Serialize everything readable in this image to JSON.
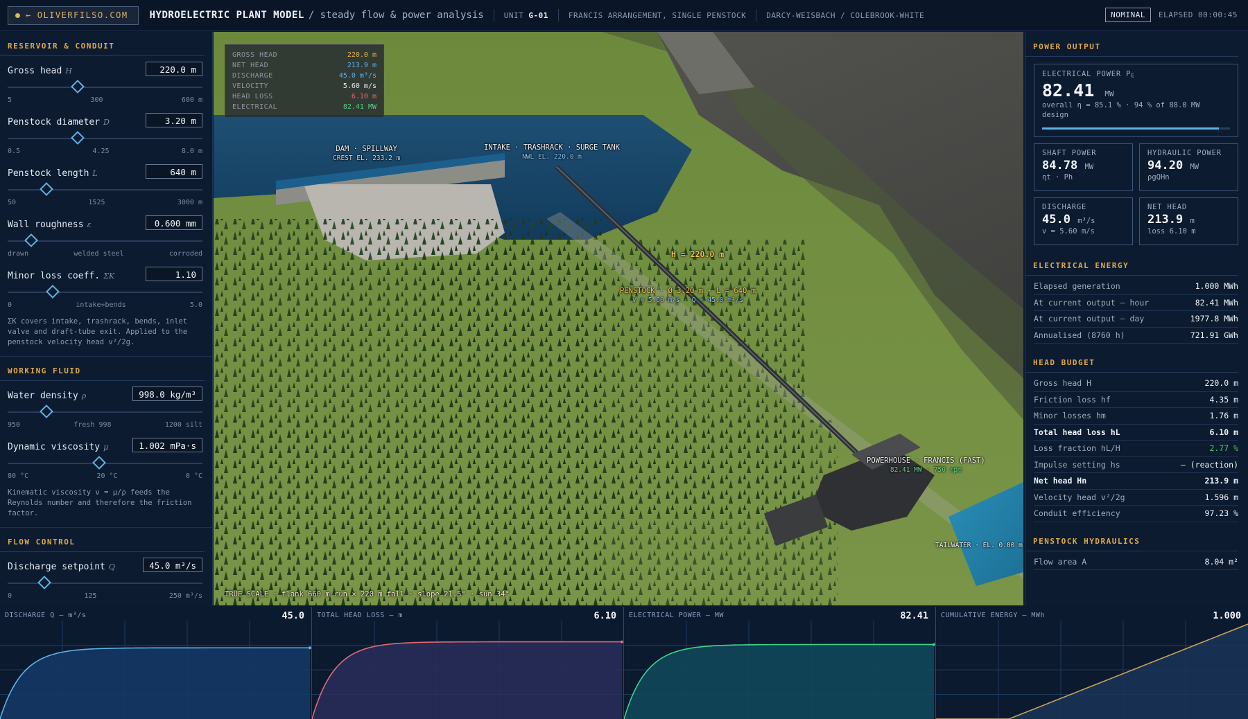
{
  "topbar": {
    "brand": "OLIVERFILSO.COM",
    "title": "HYDROELECTRIC PLANT MODEL",
    "subtitle": "/ steady flow & power analysis",
    "unit_label": "UNIT",
    "unit_value": "G-01",
    "arrangement": "FRANCIS ARRANGEMENT, SINGLE PENSTOCK",
    "method": "DARCY-WEISBACH / COLEBROOK-WHITE",
    "status": "NOMINAL",
    "elapsed": "ELAPSED 00:00:45"
  },
  "left": {
    "reservoir": {
      "title": "RESERVOIR & CONDUIT",
      "controls": [
        {
          "label": "Gross head",
          "sym": "H",
          "value": "220.0 m",
          "fraction": 0.36,
          "ticks": [
            "5",
            "300",
            "600 m"
          ]
        },
        {
          "label": "Penstock diameter",
          "sym": "D",
          "value": "3.20 m",
          "fraction": 0.36,
          "ticks": [
            "0.5",
            "4.25",
            "8.0 m"
          ]
        },
        {
          "label": "Penstock length",
          "sym": "L",
          "value": "640 m",
          "fraction": 0.2,
          "ticks": [
            "50",
            "1525",
            "3000 m"
          ]
        },
        {
          "label": "Wall roughness",
          "sym": "ε",
          "value": "0.600 mm",
          "fraction": 0.12,
          "ticks": [
            "drawn",
            "welded steel",
            "corroded"
          ]
        },
        {
          "label": "Minor loss coeff.",
          "sym": "ΣK",
          "value": "1.10",
          "fraction": 0.23,
          "ticks": [
            "0",
            "intake+bends",
            "5.0"
          ]
        }
      ],
      "note": "ΣK covers intake, trashrack, bends, inlet valve and draft-tube exit. Applied to the penstock velocity head v²/2g."
    },
    "fluid": {
      "title": "WORKING FLUID",
      "controls": [
        {
          "label": "Water density",
          "sym": "ρ",
          "value": "998.0 kg/m³",
          "fraction": 0.2,
          "ticks": [
            "950",
            "fresh 998",
            "1200 silt"
          ]
        },
        {
          "label": "Dynamic viscosity",
          "sym": "μ",
          "value": "1.002 mPa·s",
          "fraction": 0.47,
          "ticks": [
            "80 °C",
            "20 °C",
            "0 °C"
          ]
        }
      ],
      "note": "Kinematic viscosity ν = μ/ρ feeds the Reynolds number and therefore the friction factor."
    },
    "flow": {
      "title": "FLOW CONTROL",
      "controls": [
        {
          "label": "Discharge setpoint",
          "sym": "Q",
          "value": "45.0 m³/s",
          "fraction": 0.19,
          "ticks": [
            "0",
            "125",
            "250 m³/s"
          ]
        }
      ]
    }
  },
  "viewport": {
    "hud": [
      {
        "k": "GROSS HEAD",
        "v": "220.0 m",
        "color": "#e8b34d"
      },
      {
        "k": "NET HEAD",
        "v": "213.9 m",
        "color": "#5cb4e8"
      },
      {
        "k": "DISCHARGE",
        "v": "45.0 m³/s",
        "color": "#5cb4e8"
      },
      {
        "k": "VELOCITY",
        "v": "5.60 m/s",
        "color": "#e9edf3"
      },
      {
        "k": "HEAD LOSS",
        "v": "6.10 m",
        "color": "#f06565"
      },
      {
        "k": "ELECTRICAL",
        "v": "82.41 MW",
        "color": "#56d07a"
      }
    ],
    "labels": {
      "dam": "DAM · SPILLWAY",
      "dam_sub": "CREST EL. 233.2 m",
      "intake": "INTAKE · TRASHRACK · SURGE TANK",
      "intake_sub": "NWL EL. 220.0 m",
      "head": "H = 220.0 m",
      "penstock": "PENSTOCK · Ø 3.20 m · L = 640 m",
      "penstock_sub": "v = 5.60 m/s · Q = 45.0 m³/s",
      "powerhouse": "POWERHOUSE · FRANCIS (FAST)",
      "powerhouse_sub": "82.41 MW · 750 rpm",
      "tailwater": "TAILWATER · EL. 0.00 m",
      "scale": "TRUE SCALE · flank 660 m run × 220 m fall · slope 21.5° · sun 34°"
    }
  },
  "right": {
    "power": {
      "title": "POWER OUTPUT",
      "elec_label": "ELECTRICAL POWER P",
      "elec_label_sub": "E",
      "elec_value": "82.41",
      "elec_unit": "MW",
      "elec_note": "overall η = 85.1 % · 94 % of 88.0 MW design",
      "design_fraction": 0.94,
      "shaft_label": "SHAFT POWER",
      "shaft_value": "84.78",
      "shaft_unit": "MW",
      "shaft_note": "ηt · Ph",
      "hyd_label": "HYDRAULIC POWER",
      "hyd_value": "94.20",
      "hyd_unit": "MW",
      "hyd_note": "ρgQHn",
      "q_label": "DISCHARGE",
      "q_value": "45.0",
      "q_unit": "m³/s",
      "q_note": "v = 5.60 m/s",
      "hn_label": "NET HEAD",
      "hn_value": "213.9",
      "hn_unit": "m",
      "hn_note": "loss 6.10 m"
    },
    "energy": {
      "title": "ELECTRICAL ENERGY",
      "rows": [
        {
          "k": "Elapsed generation",
          "v": "1.000 MWh"
        },
        {
          "k": "At current output — hour",
          "v": "82.41 MWh"
        },
        {
          "k": "At current output — day",
          "v": "1977.8 MWh"
        },
        {
          "k": "Annualised (8760 h)",
          "v": "721.91 GWh"
        }
      ]
    },
    "budget": {
      "title": "HEAD BUDGET",
      "rows": [
        {
          "k": "Gross head H",
          "v": "220.0 m"
        },
        {
          "k": "Friction loss hf",
          "v": "4.35 m"
        },
        {
          "k": "Minor losses hm",
          "v": "1.76 m"
        },
        {
          "k": "Total head loss hL",
          "v": "6.10 m"
        },
        {
          "k": "Loss fraction hL/H",
          "v": "2.77 %"
        },
        {
          "k": "Impulse setting hs",
          "v": "— (reaction)"
        },
        {
          "k": "Net head Hn",
          "v": "213.9 m"
        },
        {
          "k": "Velocity head v²/2g",
          "v": "1.596 m"
        },
        {
          "k": "Conduit efficiency",
          "v": "97.23 %"
        }
      ]
    },
    "penstock": {
      "title": "PENSTOCK HYDRAULICS",
      "rows": [
        {
          "k": "Flow area A",
          "v": "8.04 m²"
        }
      ]
    }
  },
  "charts": [
    {
      "title": "DISCHARGE Q — m³/s",
      "value": "45.0",
      "color": "#5cb4e8",
      "fill": "#143a66",
      "ymax": 60,
      "target": 45.0,
      "kind": "rise"
    },
    {
      "title": "TOTAL HEAD LOSS — m",
      "value": "6.10",
      "color": "#e06a78",
      "fill": "#2a2e5a",
      "ymax": 7.5,
      "target": 6.1,
      "kind": "rise"
    },
    {
      "title": "ELECTRICAL POWER — MW",
      "value": "82.41",
      "color": "#3fd38a",
      "fill": "#114a5a",
      "ymax": 105,
      "target": 82.41,
      "kind": "rise"
    },
    {
      "title": "CUMULATIVE ENERGY — MWh",
      "value": "1.000",
      "color": "#c9a25a",
      "fill": "#1a3558",
      "ymax": 1.0,
      "target": 1.0,
      "kind": "linear"
    }
  ]
}
